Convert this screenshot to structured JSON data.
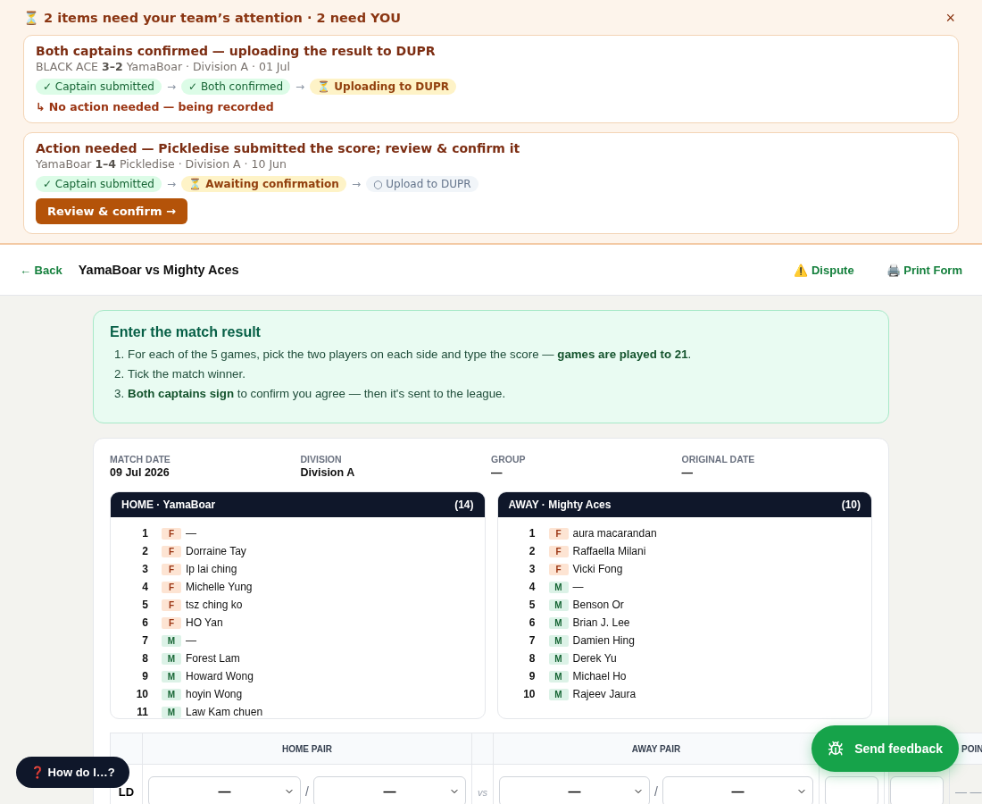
{
  "banner": {
    "title": "⏳ 2 items need your team’s attention · 2 need YOU",
    "close": "×",
    "items": [
      {
        "title": "Both captains confirmed — uploading the result to DUPR",
        "meta": "BLACK ACE **3–2** YamaBoar · Division A · 01 Jul",
        "steps": [
          {
            "label": "✓ Captain submitted",
            "kind": "done"
          },
          {
            "arrow": "→",
            "label": "✓ Both confirmed",
            "kind": "done"
          },
          {
            "arrow": "→",
            "label": "⏳ Uploading to DUPR",
            "kind": "current"
          }
        ],
        "note": "↳ No action needed — being recorded"
      },
      {
        "title": "Action needed — Pickledise submitted the score; review & confirm it",
        "meta": "YamaBoar **1–4** Pickledise · Division A · 10 Jun",
        "steps": [
          {
            "label": "✓ Captain submitted",
            "kind": "done"
          },
          {
            "arrow": "→",
            "label": "⏳ Awaiting confirmation",
            "kind": "current"
          },
          {
            "arrow": "→",
            "label": "○ Upload to DUPR",
            "kind": "pending"
          }
        ],
        "button": "Review & confirm →"
      }
    ]
  },
  "nav": {
    "back": "← Back",
    "title": "YamaBoar vs Mighty Aces",
    "actions": [
      "⚠️ Dispute",
      "🖨️ Print Form"
    ]
  },
  "instructions": {
    "title": "Enter the match result",
    "steps": [
      {
        "number": "1.",
        "text": "For each of the 5 games, pick the two players on each side and type the score — **games are played to 21**."
      },
      {
        "number": "2.",
        "text": "Tick the match winner."
      },
      {
        "number": "3.",
        "text": "**Both captains sign** to confirm you agree — then it's sent to the league."
      }
    ]
  },
  "match_info": [
    {
      "label": "MATCH DATE",
      "value": "09 Jul 2026"
    },
    {
      "label": "DIVISION",
      "value": "Division A"
    },
    {
      "label": "GROUP",
      "value": "—"
    },
    {
      "label": "ORIGINAL DATE",
      "value": "—"
    }
  ],
  "rosters": [
    {
      "title": "HOME · YamaBoar",
      "count": "(14)",
      "players": [
        {
          "number": "1",
          "gender": "F",
          "kind": "female",
          "name": "—"
        },
        {
          "number": "2",
          "gender": "F",
          "kind": "female",
          "name": "Dorraine Tay"
        },
        {
          "number": "3",
          "gender": "F",
          "kind": "female",
          "name": "Ip lai ching"
        },
        {
          "number": "4",
          "gender": "F",
          "kind": "female",
          "name": "Michelle Yung"
        },
        {
          "number": "5",
          "gender": "F",
          "kind": "female",
          "name": "tsz ching ko"
        },
        {
          "number": "6",
          "gender": "F",
          "kind": "female",
          "name": "HO Yan"
        },
        {
          "number": "7",
          "gender": "M",
          "kind": "male",
          "name": "—"
        },
        {
          "number": "8",
          "gender": "M",
          "kind": "male",
          "name": "Forest Lam"
        },
        {
          "number": "9",
          "gender": "M",
          "kind": "male",
          "name": "Howard Wong"
        },
        {
          "number": "10",
          "gender": "M",
          "kind": "male",
          "name": "hoyin Wong"
        },
        {
          "number": "11",
          "gender": "M",
          "kind": "male",
          "name": "Law Kam chuen"
        }
      ]
    },
    {
      "title": "AWAY · Mighty Aces",
      "count": "(10)",
      "players": [
        {
          "number": "1",
          "gender": "F",
          "kind": "female",
          "name": "aura macarandan"
        },
        {
          "number": "2",
          "gender": "F",
          "kind": "female",
          "name": "Raffaella Milani"
        },
        {
          "number": "3",
          "gender": "F",
          "kind": "female",
          "name": "Vicki Fong"
        },
        {
          "number": "4",
          "gender": "M",
          "kind": "male",
          "name": "—"
        },
        {
          "number": "5",
          "gender": "M",
          "kind": "male",
          "name": "Benson Or"
        },
        {
          "number": "6",
          "gender": "M",
          "kind": "male",
          "name": "Brian J. Lee"
        },
        {
          "number": "7",
          "gender": "M",
          "kind": "male",
          "name": "Damien Hing"
        },
        {
          "number": "8",
          "gender": "M",
          "kind": "male",
          "name": "Derek Yu"
        },
        {
          "number": "9",
          "gender": "M",
          "kind": "male",
          "name": "Michael Ho"
        },
        {
          "number": "10",
          "gender": "M",
          "kind": "male",
          "name": "Rajeev Jaura"
        }
      ]
    }
  ],
  "games_table": {
    "columns": {
      "home_pair": "HOME PAIR",
      "away_pair": "AWAY PAIR",
      "column_7": "POIN"
    },
    "rows": [
      {
        "label": "LD",
        "home": [
          "—",
          "—"
        ],
        "home_sep": "/",
        "vs": "vs",
        "away": [
          "—",
          "—"
        ],
        "away_sep": "/",
        "points": "— —"
      }
    ]
  },
  "help_button": "❓ How do I…?",
  "feedback_button": "Send feedback"
}
